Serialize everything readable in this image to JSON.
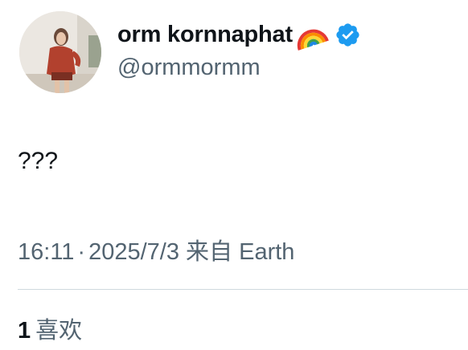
{
  "author": {
    "display_name": "orm kornnaphat",
    "handle": "@ormmormm",
    "name_emoji_icon": "rainbow-icon",
    "verified_icon": "verified-badge-icon",
    "verified_color": "#1d9bf0"
  },
  "tweet": {
    "text": "???",
    "time": "16:11",
    "separator": "·",
    "date": "2025/7/3",
    "source_prefix": "来自",
    "source": "Earth"
  },
  "stats": {
    "likes_count": "1",
    "likes_label": "喜欢"
  }
}
